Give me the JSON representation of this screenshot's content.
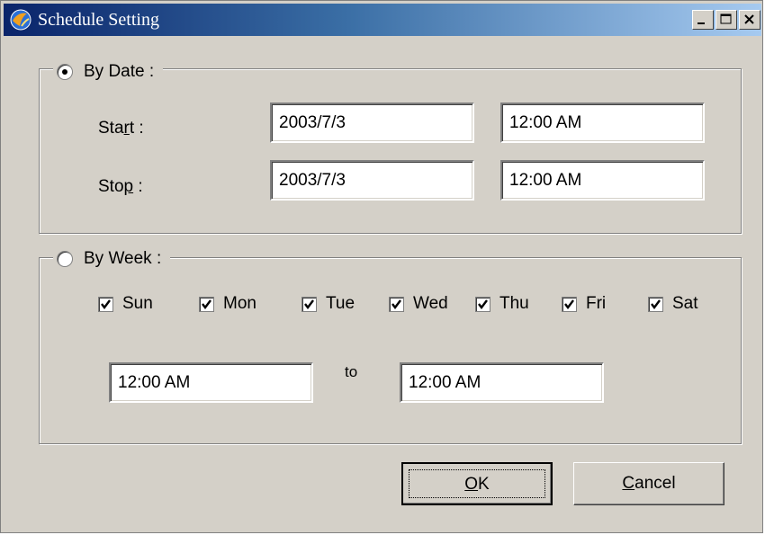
{
  "window": {
    "title": "Schedule Setting",
    "app_icon": "app-globe-icon",
    "controls": {
      "minimize": "minimize-icon",
      "maximize": "maximize-icon",
      "close": "close-icon"
    }
  },
  "by_date": {
    "label": "By Date :",
    "selected": true,
    "start": {
      "label_pre": "Sta",
      "label_mnemonic": "r",
      "label_post": "t :",
      "date": "2003/7/3",
      "time": "12:00 AM"
    },
    "stop": {
      "label_pre": "Sto",
      "label_mnemonic": "p",
      "label_post": " :",
      "date": "2003/7/3",
      "time": "12:00 AM"
    }
  },
  "by_week": {
    "label": "By Week :",
    "selected": false,
    "days": [
      {
        "label": "Sun",
        "checked": true
      },
      {
        "label": "Mon",
        "checked": true
      },
      {
        "label": "Tue",
        "checked": true
      },
      {
        "label": "Wed",
        "checked": true
      },
      {
        "label": "Thu",
        "checked": true
      },
      {
        "label": "Fri",
        "checked": true
      },
      {
        "label": "Sat",
        "checked": true
      }
    ],
    "from_time": "12:00 AM",
    "to_label": "to",
    "to_time": "12:00 AM"
  },
  "buttons": {
    "ok": {
      "mnemonic": "O",
      "rest": "K"
    },
    "cancel": {
      "mnemonic": "C",
      "rest": "ancel"
    }
  },
  "colors": {
    "titlebar_start": "#0a246a",
    "titlebar_end": "#a6caf0",
    "face": "#d4d0c8"
  }
}
